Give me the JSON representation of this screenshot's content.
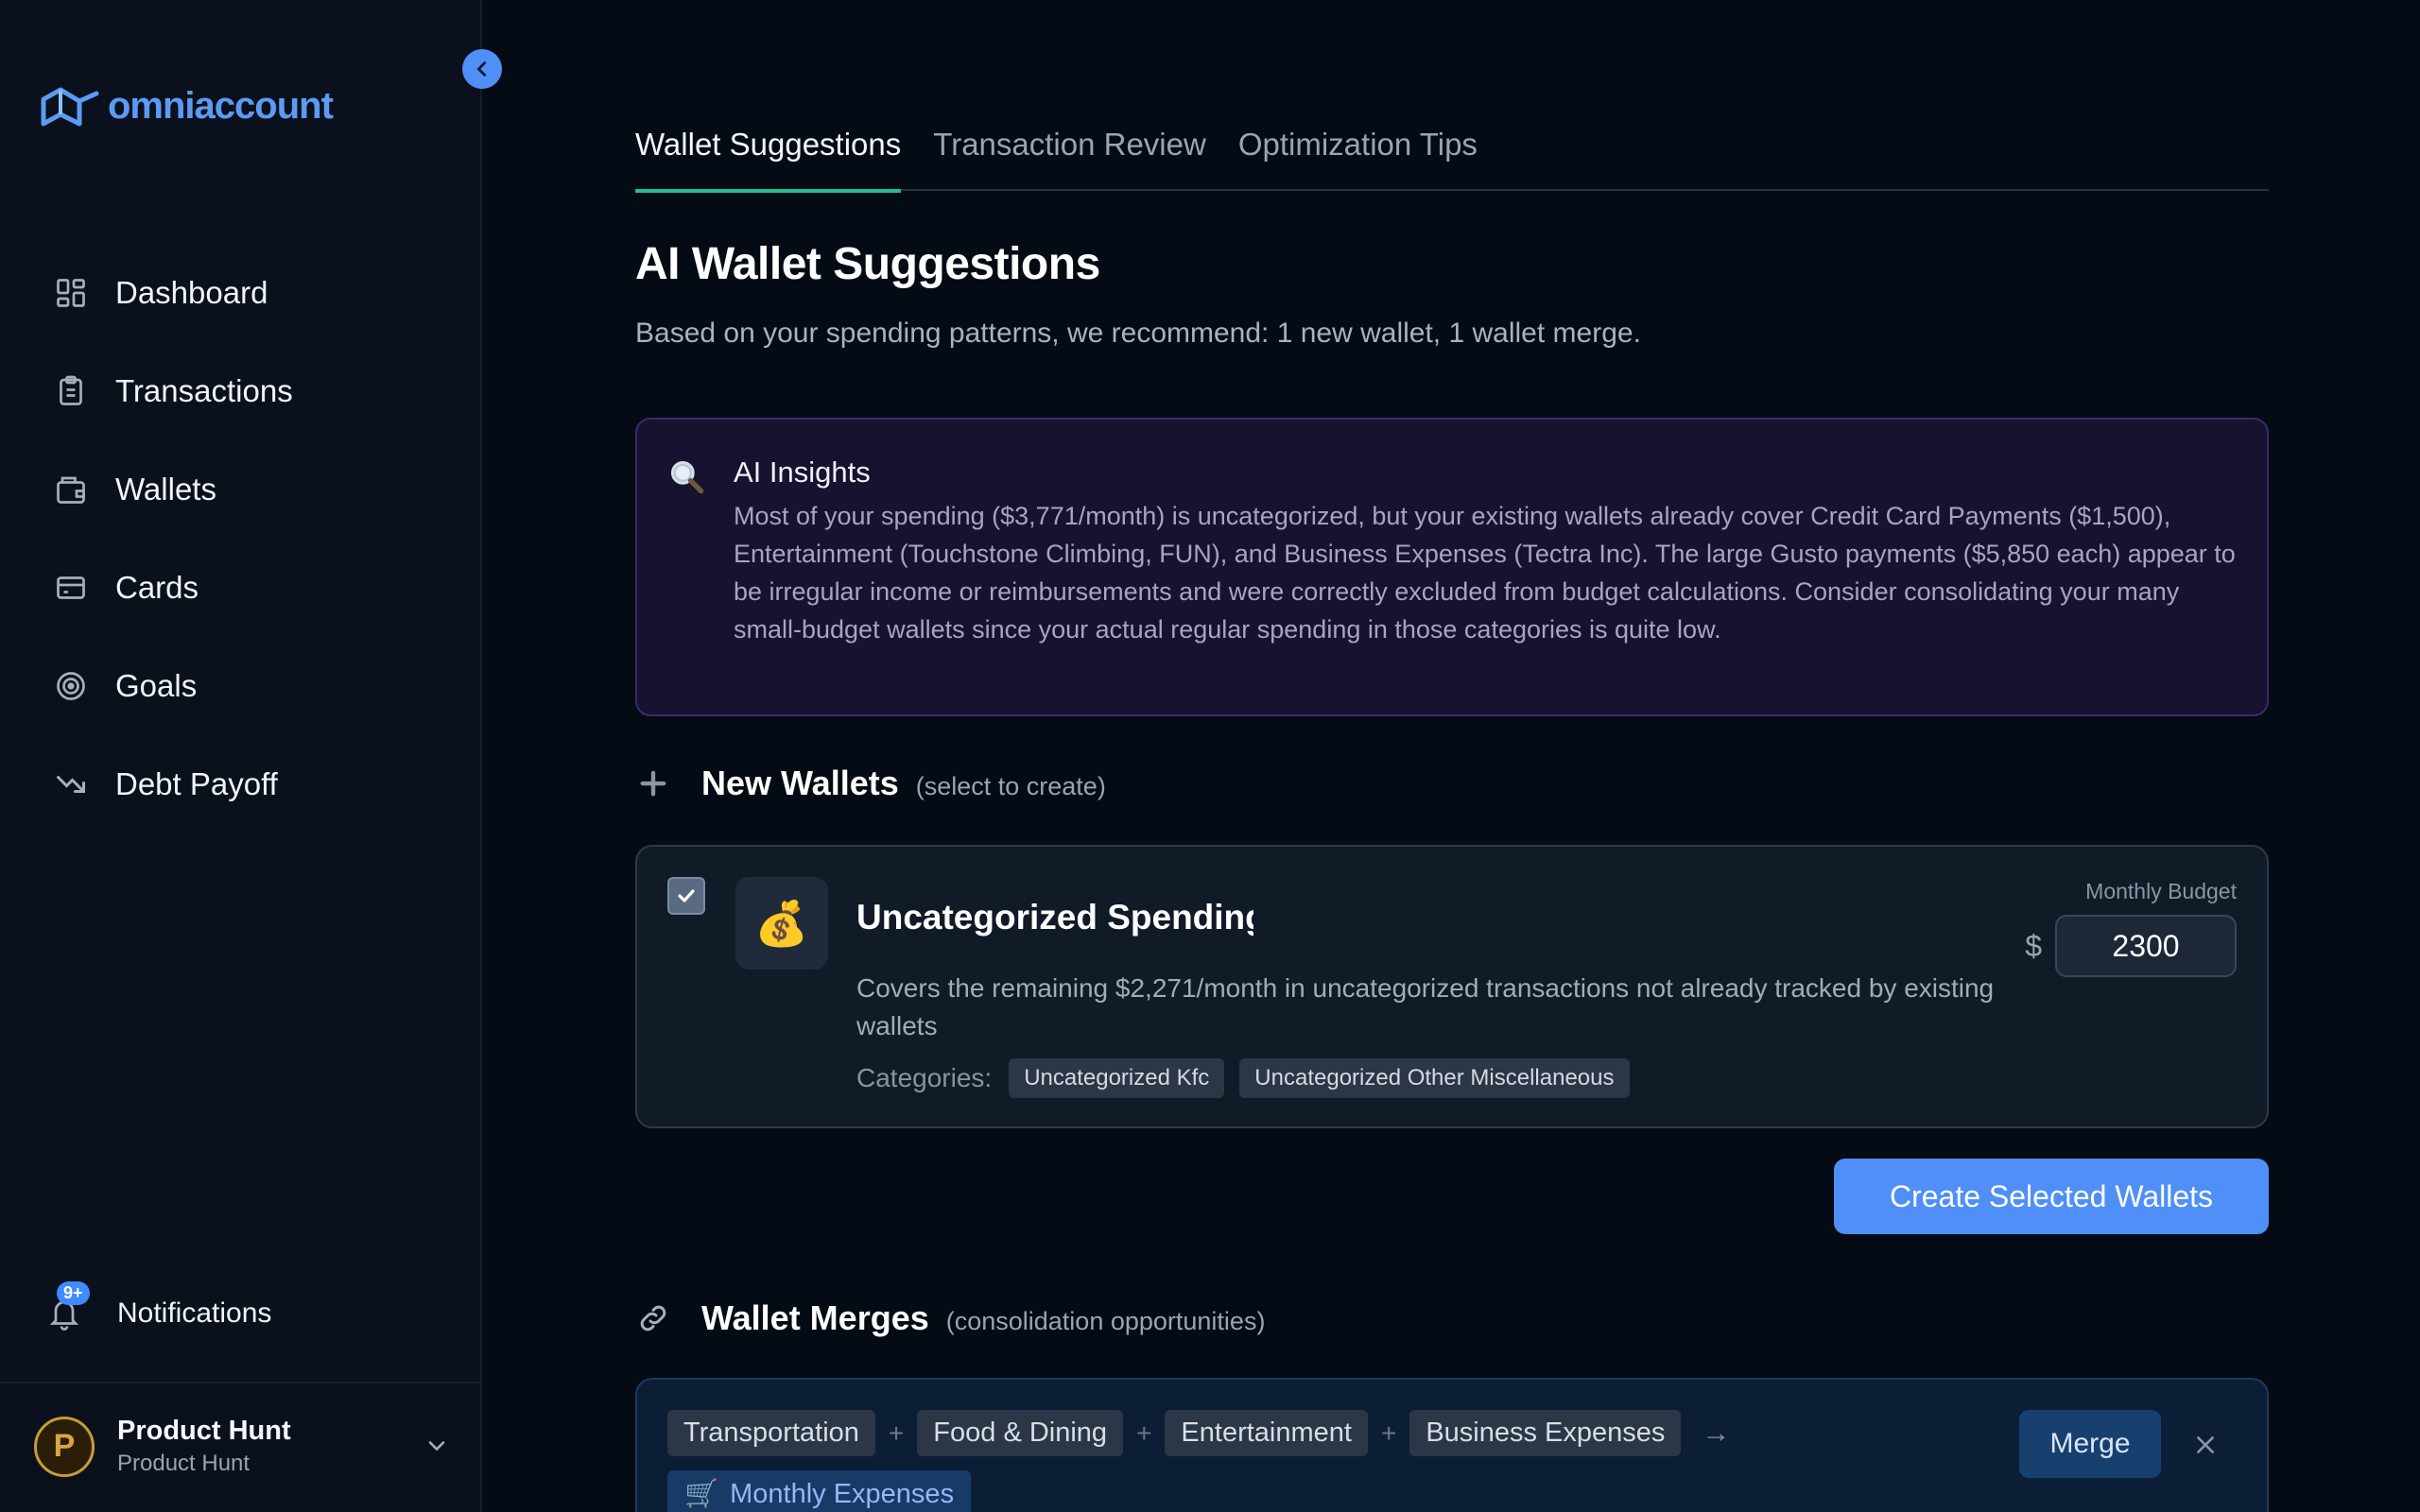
{
  "app": {
    "logo_text": "omniaccount"
  },
  "sidebar": {
    "items": [
      {
        "label": "Dashboard",
        "icon": "grid-icon"
      },
      {
        "label": "Transactions",
        "icon": "clipboard-icon"
      },
      {
        "label": "Wallets",
        "icon": "wallet-icon"
      },
      {
        "label": "Cards",
        "icon": "card-icon"
      },
      {
        "label": "Goals",
        "icon": "target-icon"
      },
      {
        "label": "Debt Payoff",
        "icon": "trending-down-icon"
      }
    ],
    "notifications": {
      "label": "Notifications",
      "badge": "9+"
    },
    "profile": {
      "name": "Product Hunt",
      "sub": "Product Hunt",
      "initial": "P"
    }
  },
  "tabs": [
    {
      "label": "Wallet Suggestions",
      "active": true
    },
    {
      "label": "Transaction Review",
      "active": false
    },
    {
      "label": "Optimization Tips",
      "active": false
    }
  ],
  "page": {
    "title": "AI Wallet Suggestions",
    "subtitle": "Based on your spending patterns, we recommend: 1 new wallet, 1 wallet merge."
  },
  "insights": {
    "title": "AI Insights",
    "body": "Most of your spending ($3,771/month) is uncategorized, but your existing wallets already cover Credit Card Payments ($1,500), Entertainment (Touchstone Climbing, FUN), and Business Expenses (Tectra Inc). The large Gusto payments ($5,850 each) appear to be irregular income or reimbursements and were correctly excluded from budget calculations. Consider consolidating your many small-budget wallets since your actual regular spending in those categories is quite low."
  },
  "new_wallets": {
    "title": "New Wallets",
    "hint": "(select to create)",
    "wallet": {
      "emoji": "💰",
      "name": "Uncategorized Spending",
      "description": "Covers the remaining $2,271/month in uncategorized transactions not already tracked by existing wallets",
      "categories_label": "Categories:",
      "categories": [
        "Uncategorized Kfc",
        "Uncategorized Other Miscellaneous"
      ],
      "budget_label": "Monthly Budget",
      "currency": "$",
      "budget_value": "2300",
      "checked": true
    },
    "create_button": "Create Selected Wallets"
  },
  "wallet_merges": {
    "title": "Wallet Merges",
    "hint": "(consolidation opportunities)",
    "sources": [
      "Transportation",
      "Food & Dining",
      "Entertainment",
      "Business Expenses"
    ],
    "plus": "+",
    "arrow": "→",
    "target": {
      "emoji": "🛒",
      "name": "Monthly Expenses"
    },
    "merge_button": "Merge"
  },
  "colors": {
    "accent": "#4f8ff7",
    "tab_underline": "#1fbf8f",
    "insight_bg": "#17122f"
  }
}
